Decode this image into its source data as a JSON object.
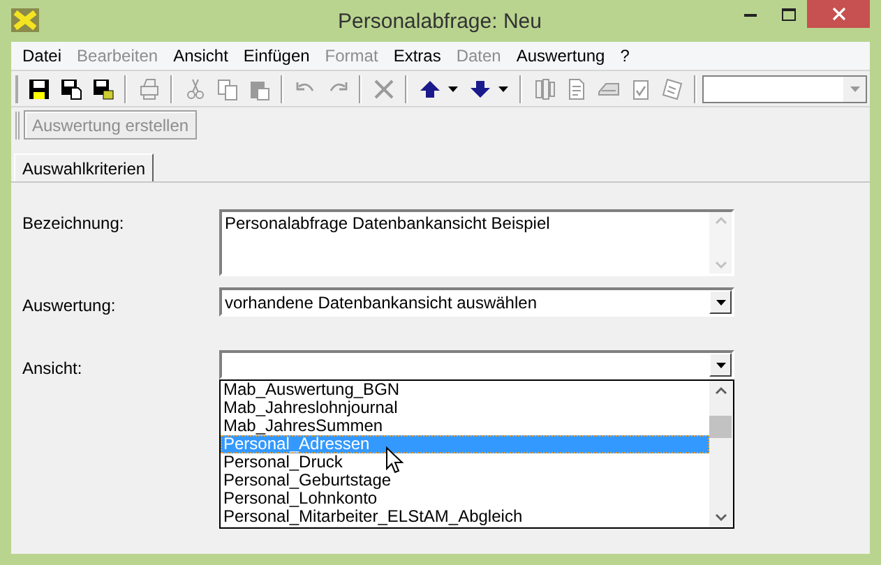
{
  "window": {
    "title": "Personalabfrage: Neu"
  },
  "menu": [
    {
      "label": "Datei",
      "disabled": false
    },
    {
      "label": "Bearbeiten",
      "disabled": true
    },
    {
      "label": "Ansicht",
      "disabled": false
    },
    {
      "label": "Einfügen",
      "disabled": false
    },
    {
      "label": "Format",
      "disabled": true
    },
    {
      "label": "Extras",
      "disabled": false
    },
    {
      "label": "Daten",
      "disabled": true
    },
    {
      "label": "Auswertung",
      "disabled": false
    },
    {
      "label": "?",
      "disabled": false
    }
  ],
  "toolbar": [
    {
      "kind": "save",
      "disabled": false
    },
    {
      "kind": "save-as",
      "disabled": false
    },
    {
      "kind": "save-all",
      "disabled": false
    },
    {
      "kind": "separator"
    },
    {
      "kind": "print",
      "disabled": true
    },
    {
      "kind": "separator"
    },
    {
      "kind": "cut",
      "disabled": true
    },
    {
      "kind": "copy",
      "disabled": true
    },
    {
      "kind": "paste",
      "disabled": true
    },
    {
      "kind": "separator"
    },
    {
      "kind": "undo",
      "disabled": true
    },
    {
      "kind": "redo",
      "disabled": true
    },
    {
      "kind": "separator"
    },
    {
      "kind": "delete",
      "disabled": true
    },
    {
      "kind": "separator"
    },
    {
      "kind": "up",
      "disabled": false
    },
    {
      "kind": "down",
      "disabled": false
    },
    {
      "kind": "separator"
    },
    {
      "kind": "columns",
      "disabled": true
    },
    {
      "kind": "document",
      "disabled": true
    },
    {
      "kind": "scanner",
      "disabled": true
    },
    {
      "kind": "checklist",
      "disabled": true
    },
    {
      "kind": "note",
      "disabled": true
    },
    {
      "kind": "separator"
    },
    {
      "kind": "combo"
    }
  ],
  "action_button": {
    "label": "Auswertung erstellen",
    "disabled": true
  },
  "tabs": [
    {
      "label": "Auswahlkriterien",
      "selected": true
    }
  ],
  "form": {
    "bezeichnung": {
      "label": "Bezeichnung:",
      "value": "Personalabfrage Datenbankansicht Beispiel"
    },
    "auswertung": {
      "label": "Auswertung:",
      "value": "vorhandene Datenbankansicht auswählen"
    },
    "ansicht": {
      "label": "Ansicht:",
      "expanded": true,
      "options": [
        {
          "label": "Mab_Auswertung_BGN",
          "selected": false
        },
        {
          "label": "Mab_Jahreslohnjournal",
          "selected": false
        },
        {
          "label": "Mab_JahresSummen",
          "selected": false
        },
        {
          "label": "Personal_Adressen",
          "selected": true
        },
        {
          "label": "Personal_Druck",
          "selected": false
        },
        {
          "label": "Personal_Geburtstage",
          "selected": false
        },
        {
          "label": "Personal_Lohnkonto",
          "selected": false
        },
        {
          "label": "Personal_Mitarbeiter_ELStAM_Abgleich",
          "selected": false
        }
      ]
    }
  }
}
